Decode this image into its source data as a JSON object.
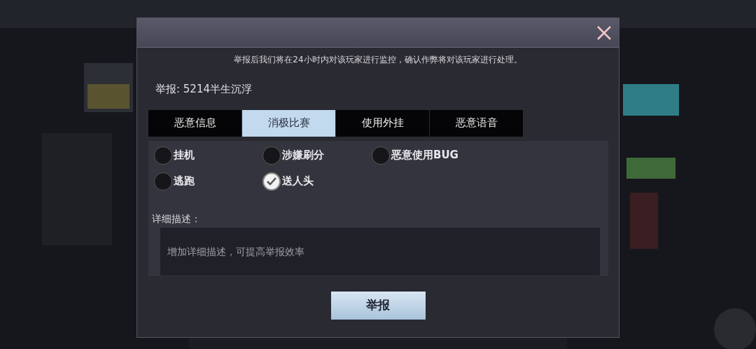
{
  "notice": "举报后我们将在24小时内对该玩家进行监控，确认作弊将对该玩家进行处理。",
  "report_target": "举报: 5214半生沉浮",
  "tabs": [
    {
      "label": "恶意信息",
      "selected": false
    },
    {
      "label": "消极比赛",
      "selected": true
    },
    {
      "label": "使用外挂",
      "selected": false
    },
    {
      "label": "恶意语音",
      "selected": false
    }
  ],
  "reasons": [
    {
      "label": "挂机",
      "selected": false
    },
    {
      "label": "涉嫌刷分",
      "selected": false
    },
    {
      "label": "恶意使用BUG",
      "selected": false
    },
    {
      "label": "逃跑",
      "selected": false
    },
    {
      "label": "送人头",
      "selected": true
    }
  ],
  "details": {
    "label": "详细描述：",
    "placeholder": "增加详细描述，可提高举报效率"
  },
  "submit_button": "举报"
}
